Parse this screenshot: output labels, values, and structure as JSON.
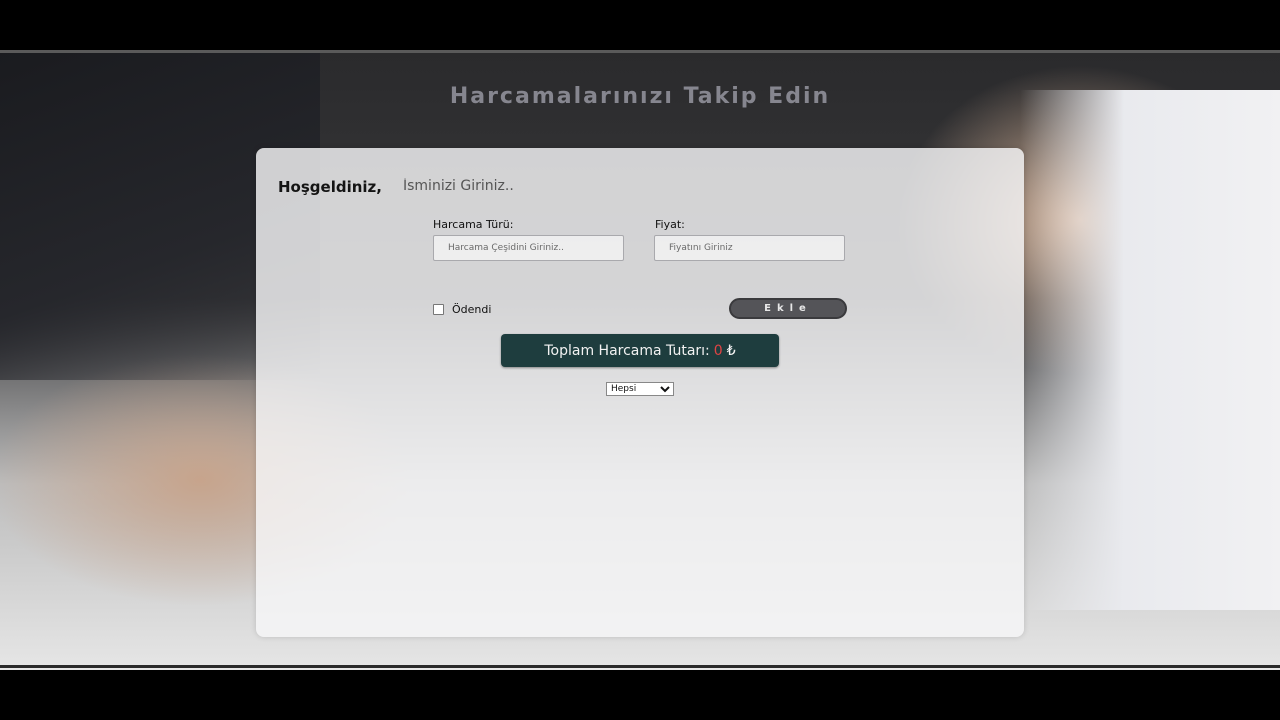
{
  "header": {
    "title": "Harcamalarınızı Takip Edin"
  },
  "welcome": {
    "label": "Hoşgeldiniz,",
    "name_placeholder": "İsminizi Giriniz.."
  },
  "form": {
    "type_label": "Harcama Türü:",
    "type_placeholder": "Harcama Çeşidini Giriniz..",
    "price_label": "Fiyat:",
    "price_placeholder": "Fiyatını Giriniz",
    "paid_label": "Ödendi",
    "add_label": "Ekle"
  },
  "total": {
    "label": "Toplam Harcama Tutarı:",
    "value": "0",
    "currency": "₺"
  },
  "filter": {
    "selected": "Hepsi"
  },
  "colors": {
    "total_bg": "#1e3d3e",
    "total_value": "#e04444",
    "button_bg": "#545458"
  }
}
